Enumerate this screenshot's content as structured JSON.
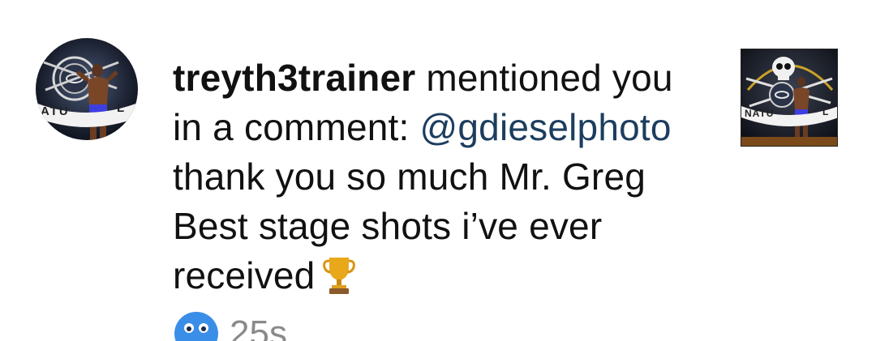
{
  "notification": {
    "username": "treyth3trainer",
    "action_text": " mentioned you in a comment: ",
    "mention": "@gdieselphoto",
    "comment_text": " thank you so much Mr. Greg Best stage shots i’ve ever received",
    "trophy_emoji": "trophy-icon",
    "reaction_emoji": "cold-face-emoji-icon",
    "timestamp": "25s"
  },
  "avatar": {
    "banner_text": "ATU",
    "banner_text_right": "L"
  },
  "post_thumbnail": {
    "banner_text": "NATU",
    "banner_text_right": "L"
  },
  "colors": {
    "text": "#111111",
    "mention": "#1c3d5e",
    "timestamp": "#8a8a8a",
    "background": "#ffffff"
  }
}
